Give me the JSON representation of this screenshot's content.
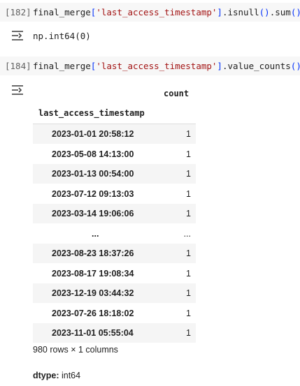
{
  "cell1": {
    "prompt": "[182]",
    "code_parts": [
      "final_merge",
      "[",
      "'last_access_timestamp'",
      "]",
      ".isnull",
      "()",
      ".sum",
      "()"
    ],
    "output": "np.int64(0)"
  },
  "cell2": {
    "prompt": "[184]",
    "code_parts": [
      "final_merge",
      "[",
      "'last_access_timestamp'",
      "]",
      ".value_counts",
      "()"
    ],
    "column_header": "count",
    "index_header": "last_access_timestamp",
    "rows": [
      {
        "index": "2023-01-01 20:58:12",
        "count": "1"
      },
      {
        "index": "2023-05-08 14:13:00",
        "count": "1"
      },
      {
        "index": "2023-01-13 00:54:00",
        "count": "1"
      },
      {
        "index": "2023-07-12 09:13:03",
        "count": "1"
      },
      {
        "index": "2023-03-14 19:06:06",
        "count": "1"
      },
      {
        "index": "...",
        "count": "..."
      },
      {
        "index": "2023-08-23 18:37:26",
        "count": "1"
      },
      {
        "index": "2023-08-17 19:08:34",
        "count": "1"
      },
      {
        "index": "2023-12-19 03:44:32",
        "count": "1"
      },
      {
        "index": "2023-07-26 18:18:02",
        "count": "1"
      },
      {
        "index": "2023-11-01 05:55:04",
        "count": "1"
      }
    ],
    "shape_text": "980 rows × 1 columns",
    "dtype_label": "dtype:",
    "dtype_value": "int64"
  },
  "icons": {
    "output": "output-toggle-icon"
  }
}
